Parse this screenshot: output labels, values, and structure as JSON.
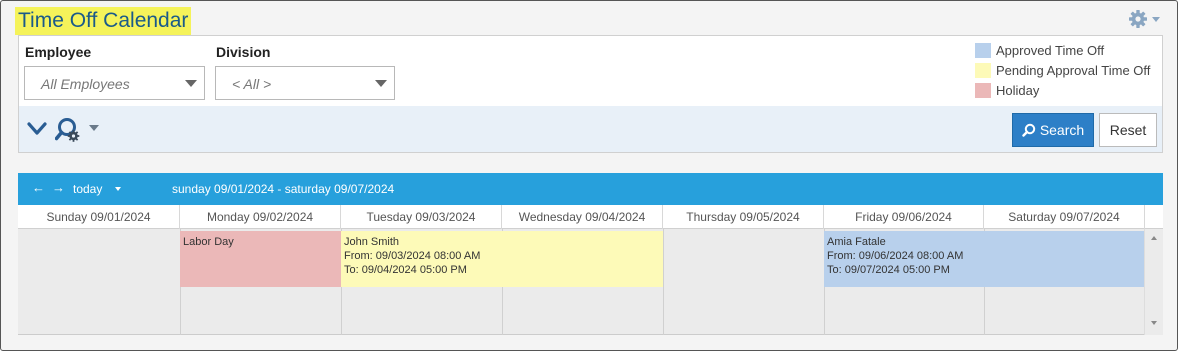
{
  "page": {
    "title": "Time Off Calendar",
    "settings_icon": "gear-icon"
  },
  "filters": {
    "employee": {
      "label": "Employee",
      "value": "All Employees"
    },
    "division": {
      "label": "Division",
      "value": "< All >"
    }
  },
  "legend": [
    {
      "label": "Approved Time Off",
      "color": "#b8d0ec"
    },
    {
      "label": "Pending Approval Time Off",
      "color": "#fdfab8"
    },
    {
      "label": "Holiday",
      "color": "#ebb8b8"
    }
  ],
  "actions": {
    "collapse_icon": "chevron-down-icon",
    "advanced_search_icon": "search-gear-icon",
    "search_label": "Search",
    "reset_label": "Reset"
  },
  "calendar": {
    "prev_icon": "arrow-left-icon",
    "next_icon": "arrow-right-icon",
    "today_label": "today",
    "range_title": "sunday 09/01/2024 - saturday 09/07/2024",
    "days": [
      "Sunday 09/01/2024",
      "Monday 09/02/2024",
      "Tuesday 09/03/2024",
      "Wednesday 09/04/2024",
      "Thursday 09/05/2024",
      "Friday 09/06/2024",
      "Saturday 09/07/2024"
    ],
    "events": [
      {
        "type": "holiday",
        "title": "Labor Day",
        "from": "",
        "to": "",
        "color": "#ebb8b8"
      },
      {
        "type": "pending",
        "title": "John Smith",
        "from": "From: 09/03/2024 08:00 AM",
        "to": "To: 09/04/2024 05:00 PM",
        "color": "#fdfab8"
      },
      {
        "type": "approved",
        "title": "Amia Fatale",
        "from": "From: 09/06/2024 08:00 AM",
        "to": "To: 09/07/2024 05:00 PM",
        "color": "#b8d0ec"
      }
    ]
  }
}
